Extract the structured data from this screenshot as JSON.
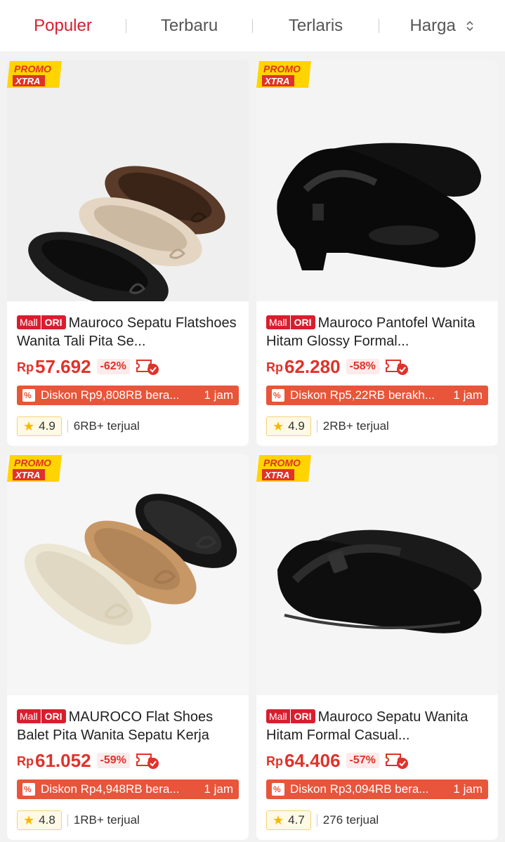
{
  "sort_tabs": [
    {
      "label": "Populer",
      "active": true
    },
    {
      "label": "Terbaru",
      "active": false
    },
    {
      "label": "Terlaris",
      "active": false
    },
    {
      "label": "Harga",
      "active": false,
      "icon": "sort-arrows-icon"
    }
  ],
  "promo_badge": {
    "line1": "PROMO",
    "line2": "XTRA"
  },
  "mall_badge": {
    "mall": "Mall",
    "ori": "ORI"
  },
  "colors": {
    "accent": "#d81e2e",
    "price": "#e0322a",
    "flash_bg": "#e8553a",
    "promo_yellow": "#ffd400"
  },
  "products": [
    {
      "title": "Mauroco Sepatu Flatshoes Wanita Tali Pita Se...",
      "currency": "Rp",
      "price": "57.692",
      "discount": "-62%",
      "flash_text": "Diskon Rp9,808RB bera...",
      "flash_time": "1 jam",
      "rating": "4.9",
      "sold": "6RB+ terjual",
      "image": "brown-beige-black-bow-flats"
    },
    {
      "title": "Mauroco Pantofel Wanita Hitam Glossy Formal...",
      "currency": "Rp",
      "price": "62.280",
      "discount": "-58%",
      "flash_text": "Diskon Rp5,22RB berakh...",
      "flash_time": "1 jam",
      "rating": "4.9",
      "sold": "2RB+ terjual",
      "image": "black-glossy-mary-jane"
    },
    {
      "title": "MAUROCO Flat Shoes Balet Pita Wanita Sepatu Kerja",
      "currency": "Rp",
      "price": "61.052",
      "discount": "-59%",
      "flash_text": "Diskon Rp4,948RB bera...",
      "flash_time": "1 jam",
      "rating": "4.8",
      "sold": "1RB+ terjual",
      "image": "cream-tan-black-ballet-flats"
    },
    {
      "title": "Mauroco Sepatu Wanita Hitam Formal Casual...",
      "currency": "Rp",
      "price": "64.406",
      "discount": "-57%",
      "flash_text": "Diskon Rp3,094RB bera...",
      "flash_time": "1 jam",
      "rating": "4.7",
      "sold": "276 terjual",
      "image": "black-matte-mary-jane"
    }
  ]
}
